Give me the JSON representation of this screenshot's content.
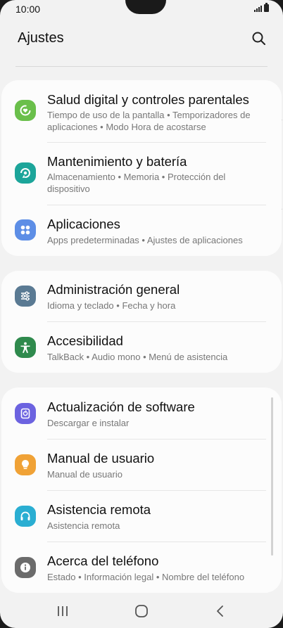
{
  "status_bar": {
    "time": "10:00"
  },
  "header": {
    "title": "Ajustes"
  },
  "sections": [
    {
      "items": [
        {
          "title": "Salud digital y controles parentales",
          "subtitle": "Tiempo de uso de la pantalla  •  Temporizadores de aplicaciones  •  Modo Hora de acostarse",
          "icon": "digital-wellbeing-icon",
          "color": "#6abf4b"
        },
        {
          "title": "Mantenimiento y batería",
          "subtitle": "Almacenamiento  •  Memoria  •  Protección del dispositivo",
          "icon": "device-care-icon",
          "color": "#1ca59a"
        },
        {
          "title": "Aplicaciones",
          "subtitle": "Apps predeterminadas  •  Ajustes de aplicaciones",
          "icon": "apps-icon",
          "color": "#5d8ee6"
        }
      ]
    },
    {
      "items": [
        {
          "title": "Administración general",
          "subtitle": "Idioma y teclado  •  Fecha y hora",
          "icon": "general-management-icon",
          "color": "#5a7a93"
        },
        {
          "title": "Accesibilidad",
          "subtitle": "TalkBack  •  Audio mono  •  Menú de asistencia",
          "icon": "accessibility-icon",
          "color": "#2f8a4d"
        }
      ]
    },
    {
      "items": [
        {
          "title": "Actualización de software",
          "subtitle": "Descargar e instalar",
          "icon": "software-update-icon",
          "color": "#6c63e0"
        },
        {
          "title": "Manual de usuario",
          "subtitle": "Manual de usuario",
          "icon": "lightbulb-icon",
          "color": "#f0a236"
        },
        {
          "title": "Asistencia remota",
          "subtitle": "Asistencia remota",
          "icon": "headset-icon",
          "color": "#2aaed2"
        },
        {
          "title": "Acerca del teléfono",
          "subtitle": "Estado  •  Información legal  •  Nombre del teléfono",
          "icon": "info-icon",
          "color": "#6b6b6b"
        }
      ]
    }
  ]
}
